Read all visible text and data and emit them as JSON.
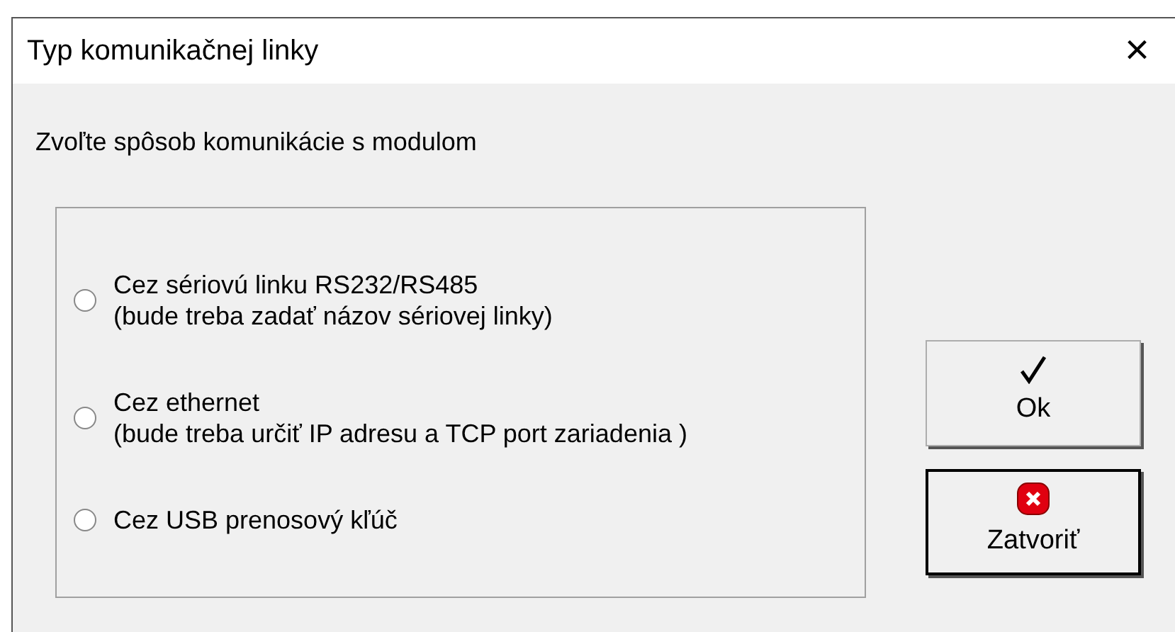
{
  "window": {
    "title": "Typ komunikačnej linky",
    "close": "×"
  },
  "prompt": "Zvoľte spôsob komunikácie s modulom",
  "options": [
    {
      "label": "Cez sériovú linku RS232/RS485",
      "note": "(bude treba zadať názov sériovej linky)",
      "selected": false
    },
    {
      "label": "Cez ethernet",
      "note": "(bude treba určiť IP adresu a TCP port zariadenia )",
      "selected": false
    },
    {
      "label": "Cez USB prenosový kľúč",
      "selected": false
    }
  ],
  "buttons": [
    {
      "kind": "ok",
      "label": "Ok"
    },
    {
      "kind": "close",
      "label": "Zatvoriť"
    }
  ]
}
